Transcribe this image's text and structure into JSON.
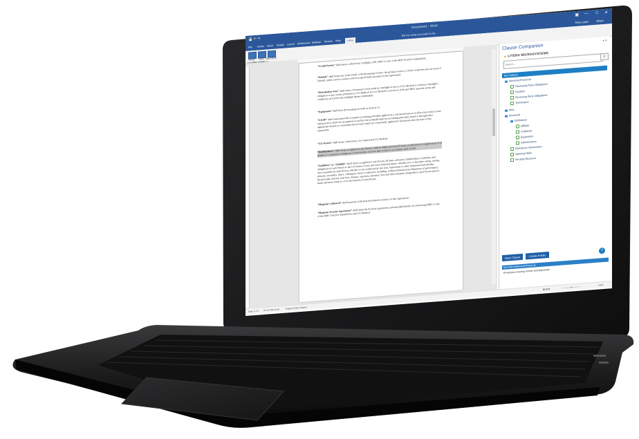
{
  "word": {
    "document_title": "Document1 - Word",
    "tell_me": "Tell me what you want to do...",
    "user": "Theo Lister",
    "share": "Share",
    "tabs": [
      "File",
      "Home",
      "Insert",
      "Design",
      "Layout",
      "References",
      "Mailings",
      "Review",
      "View",
      "Litera"
    ],
    "ribbon": {
      "buttons": [
        "Clause Companion",
        "Insert Clause",
        "Save Clause"
      ],
      "group_label": "Clause Companion"
    },
    "status": {
      "page": "Page 1 of 1",
      "words": "25 of 2409 words",
      "language": "English (United States)",
      "zoom": "100%"
    }
  },
  "document": {
    "paragraphs": [
      {
        "term": "“Credit Parties”",
        "text": " shall mean, collectively, Outflight, ASE, MBC or any of the MBC FirstTier Subsidiaries."
      },
      {
        "term": "“Default”",
        "text": " shall mean any event which, with the passage of time, the giving of notice, or both, would become an event of Default, unless cured or unless waived as specifically provided in this Agreement."
      },
      {
        "term": "“Distribution Note”",
        "text": " shall mean a Promissory Note made by Outflight in favor of GG Medical to evidence Outflight’s obligation to pay certain premiums to GG Medical for GG Medical’s services to ASE and MBC upon the terms and conditions set forth in the Outflight Master Addendum."
      },
      {
        "term": "“Equipment”",
        "text": " shall have the meaning set forth in Section 2.1."
      },
      {
        "term": "“GAAP”",
        "text": " shall mean generally accepted accounting principles applied on a consistent basis as in effect from time to time and practices which are recognized as such by the acting through its accounting principles board or through other appropriate boards or committees thereof and which are consistently applied for all periods after the date of this Agreement."
      },
      {
        "term": "“GG Parties”",
        "text": " shall mean, collectively, GG Capital and GG Medical."
      },
      {
        "term": "“Indebtedness”",
        "text": " shall mean, as applied to any Person, without duplication (a) all items, except items of capital stock or of surplus or of general contingency or deferred tax reserves that would, in accordance with GAAP.",
        "highlight": true
      },
      {
        "term": "“Liabilities” or “Liability”",
        "text": " shall mean, as applied to any Person, all loans, advances, Indebtedness, Liabilities, and obligations of such Person to the GG Parties of any and every kind and nature, whether now or hereafter owing, arising, due or payable by such Person, whether or not evidenced by any note, Agreement or other instrument and whether primary, secondary, direct, contingent, fixed or otherwise, including, without limitation (a) obligations of performance, (b) principal, interest, loan fees, charges, expenses, attorneys’ fees and other amounts chargeable to such Person and (c) future advances made to or for the benefit of such Person."
      },
      {
        "term": "“Magnum Collateral”",
        "text": " shall mean the Collateral described in Article I of this Agreement."
      },
      {
        "term": "“Magnum Security Agreement”",
        "text": " shall mean the Security Agreement, and amended hereby, by and among MBC or any of the MBC FirstTier Subsidiaries and GG Medical."
      }
    ]
  },
  "panel": {
    "title": "Clause Companion",
    "logo": "LITERA MICROSYSTEMS",
    "search_placeholder": "Search...",
    "tree_header": "My Folders",
    "tree": [
      {
        "label": "Monetary/Financial",
        "type": "folder",
        "depth": 0
      },
      {
        "label": "Disclosing Party Obligations",
        "type": "clause",
        "depth": 1
      },
      {
        "label": "Duration",
        "type": "clause",
        "depth": 1
      },
      {
        "label": "Receiving Party Obligations",
        "type": "clause",
        "depth": 1
      },
      {
        "label": "Termination",
        "type": "clause",
        "depth": 1
      },
      {
        "label": "Misc",
        "type": "folder",
        "depth": 0
      },
      {
        "label": "Structural",
        "type": "folder",
        "depth": 0
      },
      {
        "label": "Definitions",
        "type": "folder",
        "depth": 1
      },
      {
        "label": "Affiliate",
        "type": "clause",
        "depth": 2
      },
      {
        "label": "Collateral",
        "type": "clause",
        "depth": 2
      },
      {
        "label": "Equipment",
        "type": "clause",
        "depth": 2
      },
      {
        "label": "Indebtedness",
        "type": "clause",
        "depth": 2
      },
      {
        "label": "Definitions Introduction",
        "type": "clause",
        "depth": 1
      },
      {
        "label": "Opening Rider",
        "type": "clause",
        "depth": 1
      },
      {
        "label": "Recitals Structure",
        "type": "clause",
        "depth": 1
      }
    ],
    "save_clause": "Save Clause",
    "create_folder": "Create Folder",
    "path": "My Folders\\Monetary/Financial",
    "description": "Provisions covering money and payments"
  },
  "colors": {
    "word_blue": "#2b579a",
    "panel_blue": "#1f7fc4",
    "logo_orange": "#e8892a"
  }
}
